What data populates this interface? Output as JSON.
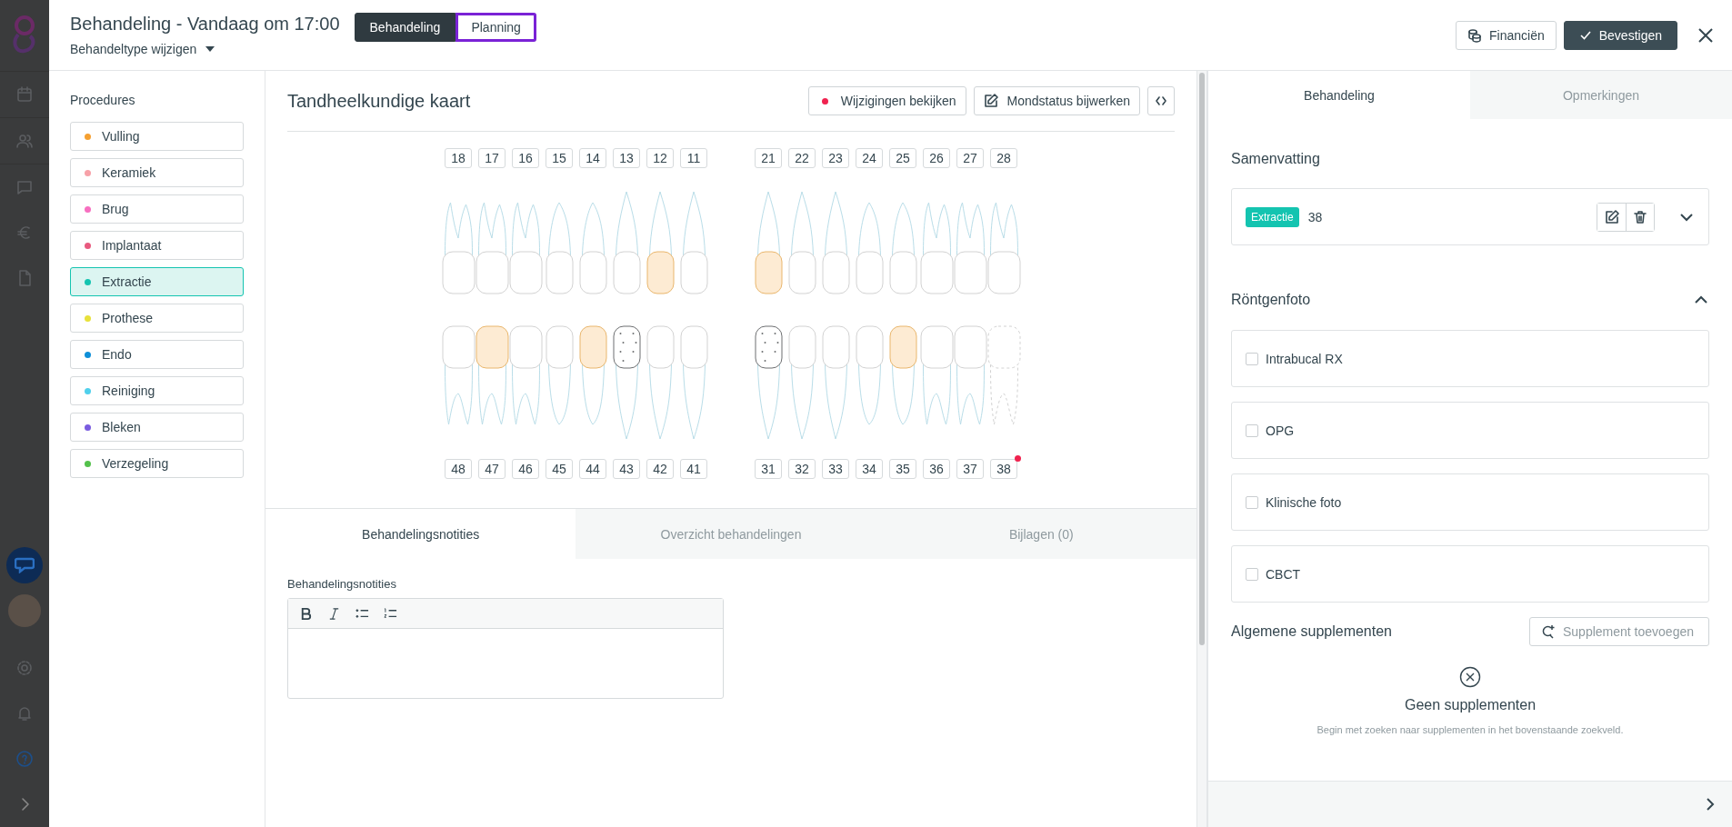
{
  "header": {
    "title": "Behandeling - Vandaag om 17:00",
    "type_selector": "Behandeltype wijzigen",
    "view_tabs": [
      {
        "label": "Behandeling",
        "selected": true,
        "focused": false
      },
      {
        "label": "Planning",
        "selected": false,
        "focused": true
      }
    ],
    "buttons": [
      {
        "label": "Financiën",
        "kind": "secondary"
      },
      {
        "label": "Bevestigen",
        "kind": "primary"
      }
    ]
  },
  "procedures": {
    "title": "Procedures",
    "items": [
      {
        "label": "Vulling",
        "color": "#f5a031",
        "selected": false
      },
      {
        "label": "Keramiek",
        "color": "#f7a1a8",
        "selected": false
      },
      {
        "label": "Brug",
        "color": "#f76fc0",
        "selected": false
      },
      {
        "label": "Implantaat",
        "color": "#e85a7f",
        "selected": false
      },
      {
        "label": "Extractie",
        "color": "#14c4b0",
        "selected": true
      },
      {
        "label": "Prothese",
        "color": "#e8e13a",
        "selected": false
      },
      {
        "label": "Endo",
        "color": "#0e8fd8",
        "selected": false
      },
      {
        "label": "Reiniging",
        "color": "#50d0ec",
        "selected": false
      },
      {
        "label": "Bleken",
        "color": "#7a5ce0",
        "selected": false
      },
      {
        "label": "Verzegeling",
        "color": "#53c14b",
        "selected": false
      }
    ]
  },
  "chart": {
    "title": "Tandheelkundige kaart",
    "actions": [
      {
        "label": "Wijzigingen bekijken",
        "kind": "dot"
      },
      {
        "label": "Mondstatus bijwerken",
        "kind": "edit"
      }
    ],
    "upper": [
      {
        "number": "18",
        "filled": false,
        "dotted": false,
        "missing": false,
        "marked": false
      },
      {
        "number": "17",
        "filled": false,
        "dotted": false,
        "missing": false,
        "marked": false
      },
      {
        "number": "16",
        "filled": false,
        "dotted": false,
        "missing": false,
        "marked": false
      },
      {
        "number": "15",
        "filled": false,
        "dotted": false,
        "missing": false,
        "marked": false
      },
      {
        "number": "14",
        "filled": false,
        "dotted": false,
        "missing": false,
        "marked": false
      },
      {
        "number": "13",
        "filled": false,
        "dotted": false,
        "missing": false,
        "marked": false
      },
      {
        "number": "12",
        "filled": true,
        "dotted": false,
        "missing": false,
        "marked": false
      },
      {
        "number": "11",
        "filled": false,
        "dotted": false,
        "missing": false,
        "marked": false
      },
      {
        "number": "21",
        "filled": true,
        "dotted": false,
        "missing": false,
        "marked": false
      },
      {
        "number": "22",
        "filled": false,
        "dotted": false,
        "missing": false,
        "marked": false
      },
      {
        "number": "23",
        "filled": false,
        "dotted": false,
        "missing": false,
        "marked": false
      },
      {
        "number": "24",
        "filled": false,
        "dotted": false,
        "missing": false,
        "marked": false
      },
      {
        "number": "25",
        "filled": false,
        "dotted": false,
        "missing": false,
        "marked": false
      },
      {
        "number": "26",
        "filled": false,
        "dotted": false,
        "missing": false,
        "marked": false
      },
      {
        "number": "27",
        "filled": false,
        "dotted": false,
        "missing": false,
        "marked": false
      },
      {
        "number": "28",
        "filled": false,
        "dotted": false,
        "missing": false,
        "marked": false
      }
    ],
    "lower": [
      {
        "number": "48",
        "filled": false,
        "dotted": false,
        "missing": false,
        "marked": false
      },
      {
        "number": "47",
        "filled": true,
        "dotted": false,
        "missing": false,
        "marked": false
      },
      {
        "number": "46",
        "filled": false,
        "dotted": false,
        "missing": false,
        "marked": false
      },
      {
        "number": "45",
        "filled": false,
        "dotted": false,
        "missing": false,
        "marked": false
      },
      {
        "number": "44",
        "filled": true,
        "dotted": false,
        "missing": false,
        "marked": false
      },
      {
        "number": "43",
        "filled": false,
        "dotted": true,
        "missing": false,
        "marked": false
      },
      {
        "number": "42",
        "filled": false,
        "dotted": false,
        "missing": false,
        "marked": false
      },
      {
        "number": "41",
        "filled": false,
        "dotted": false,
        "missing": false,
        "marked": false
      },
      {
        "number": "31",
        "filled": false,
        "dotted": true,
        "missing": false,
        "marked": false
      },
      {
        "number": "32",
        "filled": false,
        "dotted": false,
        "missing": false,
        "marked": false
      },
      {
        "number": "33",
        "filled": false,
        "dotted": false,
        "missing": false,
        "marked": false
      },
      {
        "number": "34",
        "filled": false,
        "dotted": false,
        "missing": false,
        "marked": false
      },
      {
        "number": "35",
        "filled": true,
        "dotted": false,
        "missing": false,
        "marked": false
      },
      {
        "number": "36",
        "filled": false,
        "dotted": false,
        "missing": false,
        "marked": false
      },
      {
        "number": "37",
        "filled": false,
        "dotted": false,
        "missing": false,
        "marked": false
      },
      {
        "number": "38",
        "filled": false,
        "dotted": false,
        "missing": true,
        "marked": true
      }
    ]
  },
  "notes": {
    "tabs": [
      {
        "label": "Behandelingsnotities",
        "selected": true
      },
      {
        "label": "Overzicht behandelingen",
        "selected": false
      },
      {
        "label": "Bijlagen (0)",
        "selected": false
      }
    ],
    "field_label": "Behandelingsnotities"
  },
  "side": {
    "tabs": [
      {
        "label": "Behandeling",
        "selected": true
      },
      {
        "label": "Opmerkingen",
        "selected": false
      }
    ],
    "summary": {
      "title": "Samenvatting",
      "entries": [
        {
          "tag": "Extractie",
          "color": "#14c4b0",
          "teeth": "38",
          "expanded": false
        }
      ]
    },
    "xray": {
      "title": "Röntgenfoto",
      "expanded": true,
      "options": [
        {
          "label": "Intrabucal RX",
          "checked": false
        },
        {
          "label": "OPG",
          "checked": false
        },
        {
          "label": "Klinische foto",
          "checked": false
        },
        {
          "label": "CBCT",
          "checked": false
        }
      ]
    },
    "supplements": {
      "title": "Algemene supplementen",
      "add_button": "Supplement toevoegen",
      "empty_title": "Geen supplementen",
      "empty_hint": "Begin met zoeken naar supplementen in het bovenstaande zoekveld."
    }
  }
}
